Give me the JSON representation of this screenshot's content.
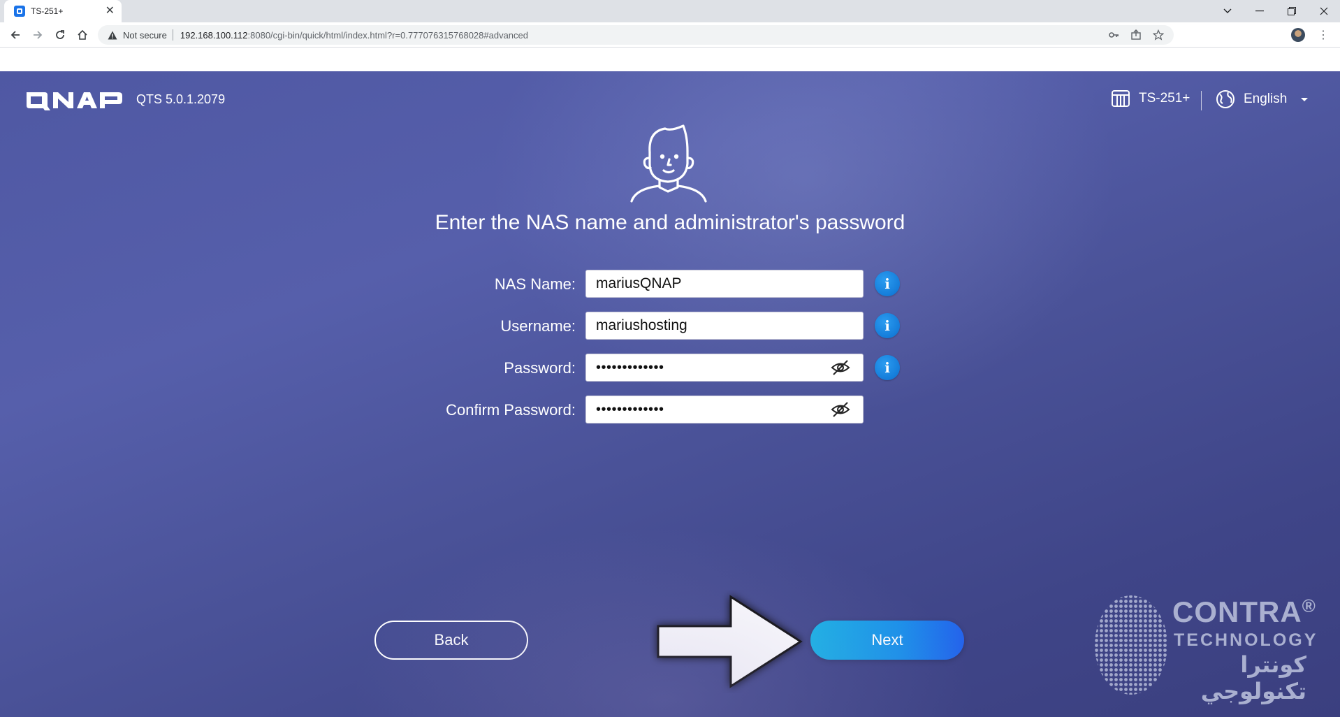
{
  "browser": {
    "tab_title": "TS-251+",
    "security_label": "Not secure",
    "url_host": "192.168.100.112",
    "url_rest": ":8080/cgi-bin/quick/html/index.html?r=0.777076315768028#advanced"
  },
  "header": {
    "logo_text": "QNAP",
    "version": "QTS 5.0.1.2079",
    "device_name": "TS-251+",
    "language": "English"
  },
  "main": {
    "heading": "Enter the NAS name and administrator's password",
    "fields": {
      "nas_name": {
        "label": "NAS Name:",
        "value": "mariusQNAP"
      },
      "username": {
        "label": "Username:",
        "value": "mariushosting"
      },
      "password": {
        "label": "Password:",
        "value": "•••••••••••••"
      },
      "confirm_password": {
        "label": "Confirm Password:",
        "value": "•••••••••••••"
      }
    },
    "buttons": {
      "back": "Back",
      "next": "Next"
    }
  },
  "watermark": {
    "title": "CONTRA",
    "registered": "®",
    "subtitle": "TECHNOLOGY",
    "arabic": "كونترا تكنولوجي"
  },
  "colors": {
    "page_bg": "#4f58a3",
    "info_blue": "#0b6fd0",
    "next_gradient_start": "#17b3e6",
    "next_gradient_end": "#2563eb"
  },
  "icons": [
    "qnap-logo",
    "device-icon",
    "globe-icon",
    "user-avatar-icon",
    "eye-off-icon",
    "info-icon",
    "arrow-icon"
  ]
}
